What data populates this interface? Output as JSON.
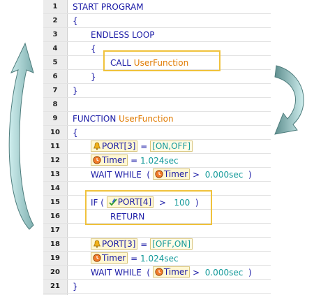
{
  "lines": [
    {
      "num": "1",
      "parts": [
        {
          "t": "START PROGRAM",
          "c": "kw"
        }
      ],
      "indent": 0
    },
    {
      "num": "2",
      "parts": [
        {
          "t": "{",
          "c": "kw"
        }
      ],
      "indent": 0
    },
    {
      "num": "3",
      "parts": [
        {
          "t": "ENDLESS LOOP",
          "c": "kw"
        }
      ],
      "indent": 1
    },
    {
      "num": "4",
      "parts": [
        {
          "t": "{",
          "c": "kw"
        }
      ],
      "indent": 1
    },
    {
      "num": "5",
      "parts": [
        {
          "t": "CALL ",
          "c": "kw"
        },
        {
          "t": "UserFunction",
          "c": "orange"
        }
      ],
      "indent": 2
    },
    {
      "num": "6",
      "parts": [
        {
          "t": "}",
          "c": "kw"
        }
      ],
      "indent": 1
    },
    {
      "num": "7",
      "parts": [
        {
          "t": "}",
          "c": "kw"
        }
      ],
      "indent": 0
    },
    {
      "num": "8",
      "parts": [],
      "indent": 0
    },
    {
      "num": "9",
      "parts": [
        {
          "t": "FUNCTION ",
          "c": "kw"
        },
        {
          "t": "UserFunction",
          "c": "orange"
        }
      ],
      "indent": 0
    },
    {
      "num": "10",
      "parts": [
        {
          "t": "{",
          "c": "kw"
        }
      ],
      "indent": 0
    },
    {
      "num": "11",
      "parts": [
        {
          "t": "PORT[3]",
          "c": "tok",
          "icon": "bell-icon"
        },
        {
          "t": " = ",
          "c": "kw"
        },
        {
          "t": "[ON,OFF]",
          "c": "tokval"
        }
      ],
      "indent": 1
    },
    {
      "num": "12",
      "parts": [
        {
          "t": "Timer",
          "c": "tok",
          "icon": "timer-icon"
        },
        {
          "t": " = ",
          "c": "kw"
        },
        {
          "t": "1.024sec",
          "c": "teal"
        }
      ],
      "indent": 1
    },
    {
      "num": "13",
      "parts": [
        {
          "t": "WAIT WHILE  ( ",
          "c": "kw"
        },
        {
          "t": "Timer",
          "c": "tok",
          "icon": "timer-icon"
        },
        {
          "t": " >  ",
          "c": "kw"
        },
        {
          "t": "0.000sec",
          "c": "teal"
        },
        {
          "t": "  )",
          "c": "kw"
        }
      ],
      "indent": 1
    },
    {
      "num": "14",
      "parts": [],
      "indent": 0
    },
    {
      "num": "15",
      "parts": [
        {
          "t": "IF ( ",
          "c": "kw"
        },
        {
          "t": "PORT[4]",
          "c": "tok",
          "icon": "check-pen-icon"
        },
        {
          "t": "  >   ",
          "c": "kw"
        },
        {
          "t": "100",
          "c": "teal"
        },
        {
          "t": "  )",
          "c": "kw"
        }
      ],
      "indent": 1
    },
    {
      "num": "16",
      "parts": [
        {
          "t": "RETURN",
          "c": "kw"
        }
      ],
      "indent": 2
    },
    {
      "num": "17",
      "parts": [],
      "indent": 0
    },
    {
      "num": "18",
      "parts": [
        {
          "t": "PORT[3]",
          "c": "tok",
          "icon": "bell-icon"
        },
        {
          "t": " = ",
          "c": "kw"
        },
        {
          "t": "[OFF,ON]",
          "c": "tokval"
        }
      ],
      "indent": 1
    },
    {
      "num": "19",
      "parts": [
        {
          "t": "Timer",
          "c": "tok",
          "icon": "timer-icon"
        },
        {
          "t": " = ",
          "c": "kw"
        },
        {
          "t": "1.024sec",
          "c": "teal"
        }
      ],
      "indent": 1
    },
    {
      "num": "20",
      "parts": [
        {
          "t": "WAIT WHILE  ( ",
          "c": "kw"
        },
        {
          "t": "Timer",
          "c": "tok",
          "icon": "timer-icon"
        },
        {
          "t": " >  ",
          "c": "kw"
        },
        {
          "t": "0.000sec",
          "c": "teal"
        },
        {
          "t": "  )",
          "c": "kw"
        }
      ],
      "indent": 1
    },
    {
      "num": "21",
      "parts": [
        {
          "t": "}",
          "c": "kw"
        }
      ],
      "indent": 0
    }
  ],
  "colors": {
    "keyword": "#1a1aa6",
    "function_name": "#e07a00",
    "value": "#149a9a",
    "highlight_box": "#f0c23c",
    "arrow": "#a9d6d6"
  }
}
